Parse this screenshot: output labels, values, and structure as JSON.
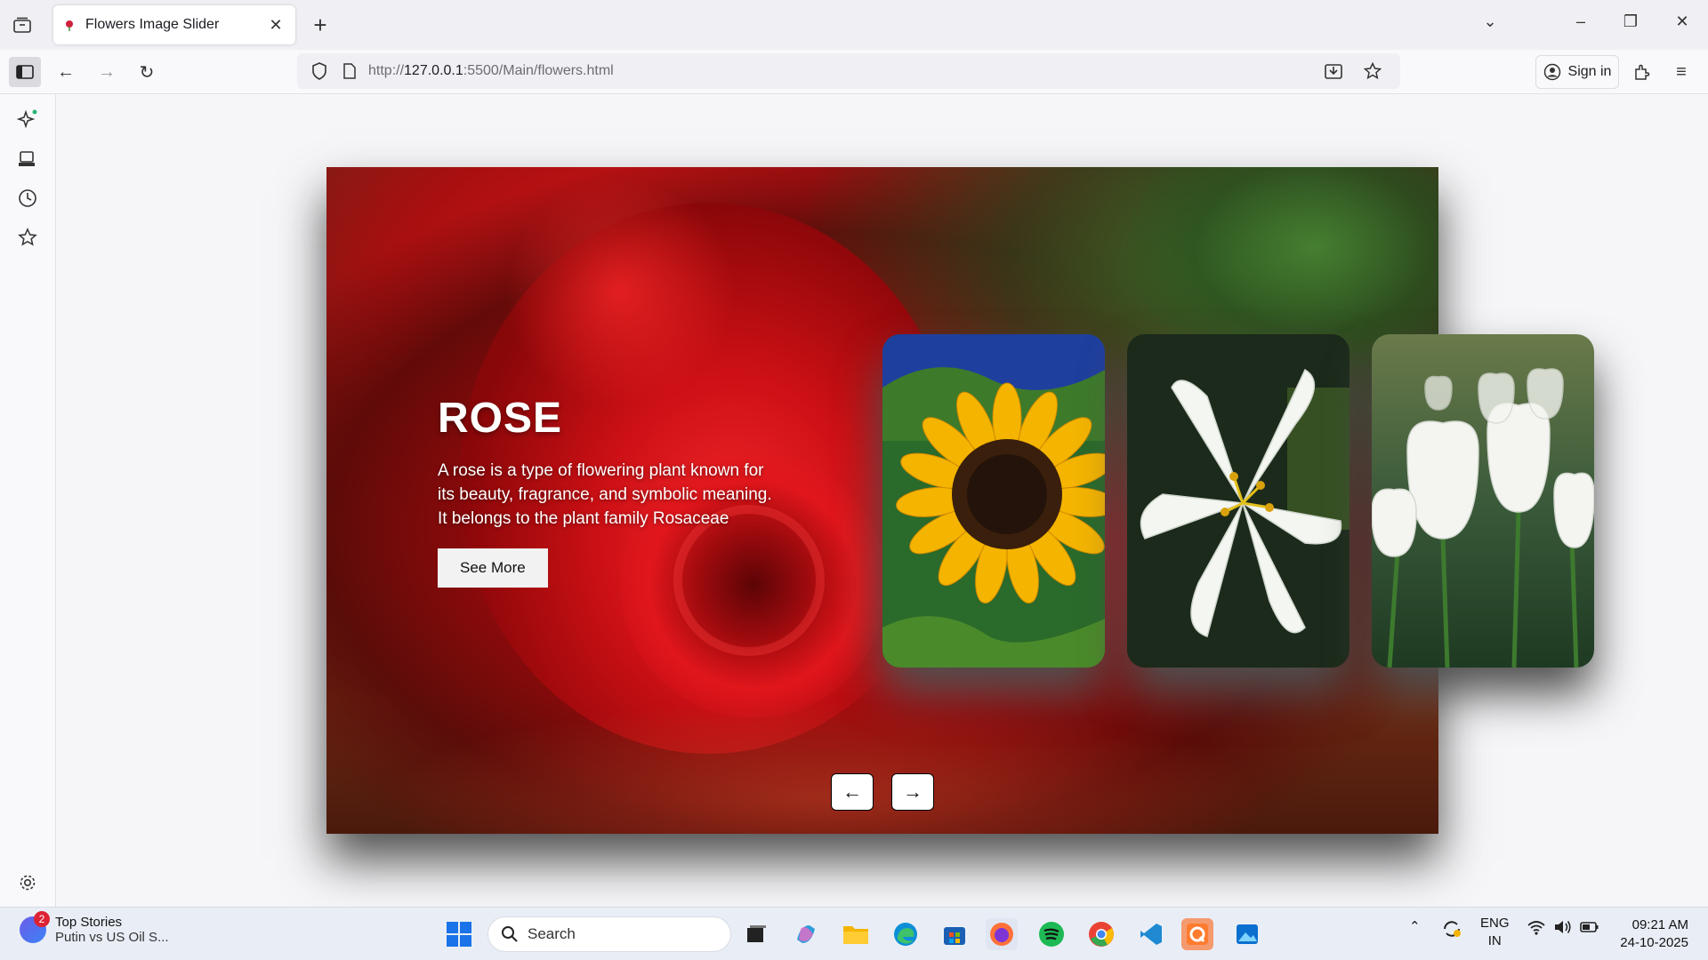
{
  "browser": {
    "tab_title": "Flowers Image Slider",
    "url_prefix": "http://",
    "url_host": "127.0.0.1",
    "url_rest": ":5500/Main/flowers.html",
    "sign_in": "Sign in"
  },
  "slider": {
    "current": {
      "name": "ROSE",
      "description": "A rose is a type of flowering plant known for its beauty, fragrance, and symbolic meaning. It belongs to the plant family Rosaceae",
      "button": "See More"
    },
    "prev_arrow": "←",
    "next_arrow": "→"
  },
  "taskbar": {
    "news_badge": "2",
    "news_title": "Top Stories",
    "news_sub": "Putin vs US Oil S...",
    "search_placeholder": "Search",
    "lang_top": "ENG",
    "lang_bottom": "IN",
    "time": "09:21 AM",
    "date": "24-10-2025"
  }
}
